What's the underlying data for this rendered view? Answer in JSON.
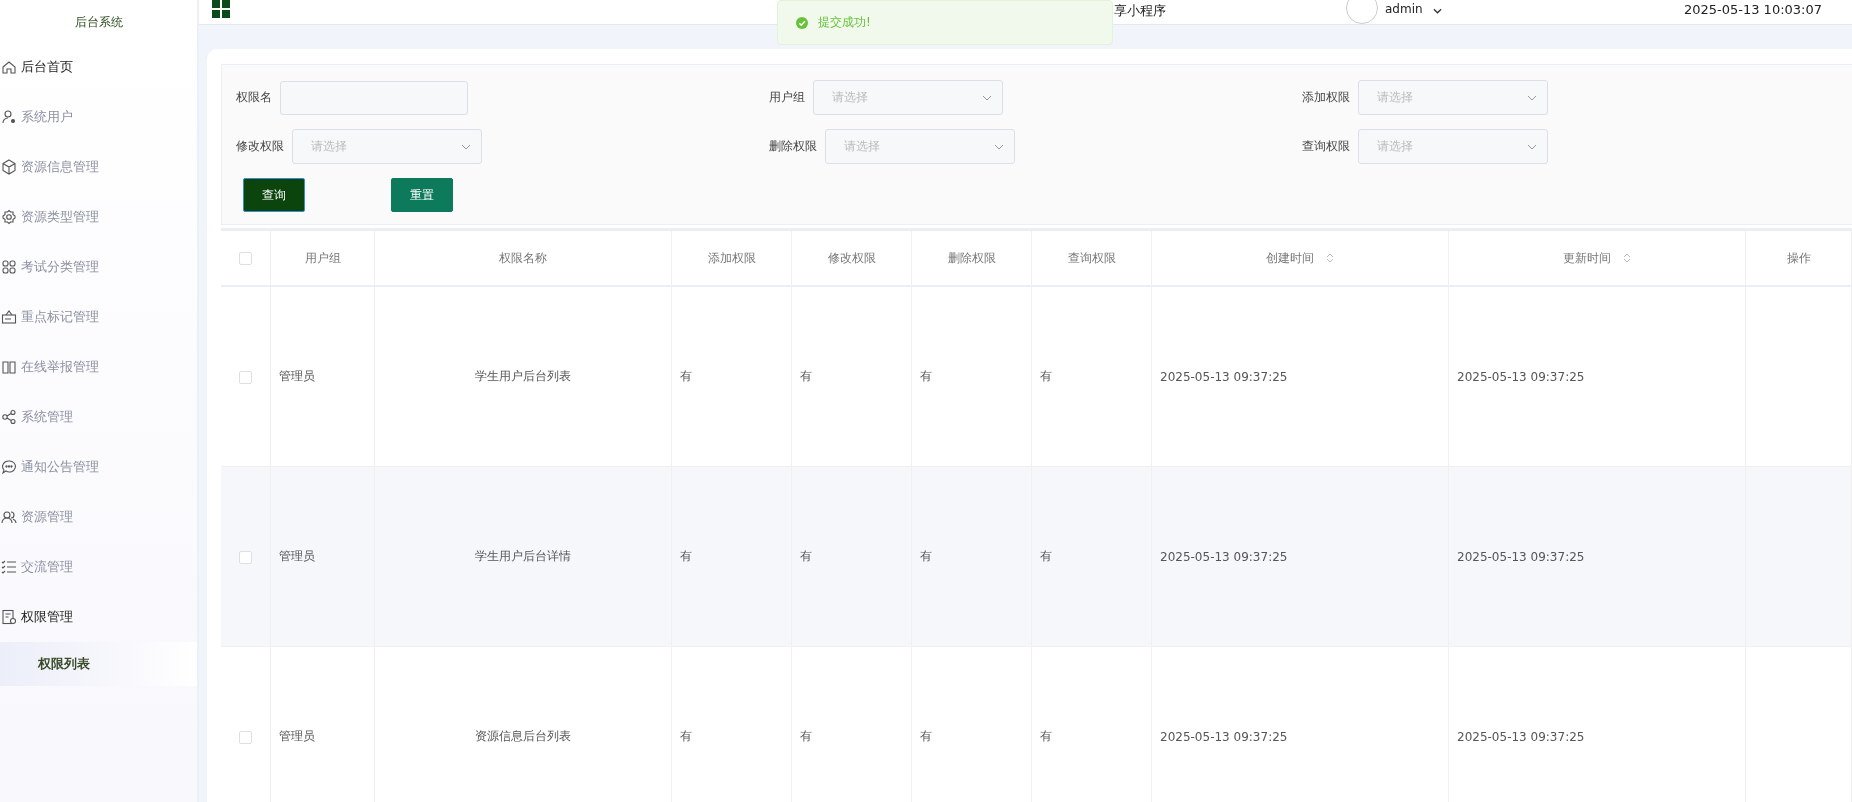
{
  "sidebar": {
    "title": "后台系统",
    "items": [
      {
        "label": "后台首页",
        "active": true
      },
      {
        "label": "系统用户",
        "active": false
      },
      {
        "label": "资源信息管理",
        "active": false
      },
      {
        "label": "资源类型管理",
        "active": false
      },
      {
        "label": "考试分类管理",
        "active": false
      },
      {
        "label": "重点标记管理",
        "active": false
      },
      {
        "label": "在线举报管理",
        "active": false
      },
      {
        "label": "系统管理",
        "active": false
      },
      {
        "label": "通知公告管理",
        "active": false
      },
      {
        "label": "资源管理",
        "active": false
      },
      {
        "label": "交流管理",
        "active": false
      },
      {
        "label": "权限管理",
        "active": true,
        "expanded": true,
        "children": [
          {
            "label": "权限列表",
            "selected": true
          }
        ]
      }
    ]
  },
  "header": {
    "title": "享小程序",
    "user": "admin",
    "datetime": "2025-05-13 10:03:07"
  },
  "toast": {
    "message": "提交成功!"
  },
  "filters": [
    {
      "label": "权限名",
      "kind": "text"
    },
    {
      "label": "用户组",
      "kind": "select",
      "placeholder": "请选择"
    },
    {
      "label": "添加权限",
      "kind": "select",
      "placeholder": "请选择"
    },
    {
      "label": "修改权限",
      "kind": "select",
      "placeholder": "请选择"
    },
    {
      "label": "删除权限",
      "kind": "select",
      "placeholder": "请选择"
    },
    {
      "label": "查询权限",
      "kind": "select",
      "placeholder": "请选择"
    }
  ],
  "buttons": [
    {
      "label": "查询",
      "kind": "primary"
    },
    {
      "label": "重置",
      "kind": "secondary"
    }
  ],
  "table": {
    "select_all_checked": false,
    "columns": [
      {
        "label": "用户组",
        "sortable": false
      },
      {
        "label": "权限名称",
        "sortable": false
      },
      {
        "label": "添加权限",
        "sortable": false
      },
      {
        "label": "修改权限",
        "sortable": false
      },
      {
        "label": "删除权限",
        "sortable": false
      },
      {
        "label": "查询权限",
        "sortable": false
      },
      {
        "label": "创建时间",
        "sortable": true
      },
      {
        "label": "更新时间",
        "sortable": true
      },
      {
        "label": "操作",
        "sortable": false
      }
    ],
    "rows": [
      {
        "checked": false,
        "cells": [
          "管理员",
          "学生用户后台列表",
          "有",
          "有",
          "有",
          "有",
          "2025-05-13 09:37:25",
          "2025-05-13 09:37:25"
        ]
      },
      {
        "checked": false,
        "cells": [
          "管理员",
          "学生用户后台详情",
          "有",
          "有",
          "有",
          "有",
          "2025-05-13 09:37:25",
          "2025-05-13 09:37:25"
        ]
      },
      {
        "checked": false,
        "cells": [
          "管理员",
          "资源信息后台列表",
          "有",
          "有",
          "有",
          "有",
          "2025-05-13 09:37:25",
          "2025-05-13 09:37:25"
        ]
      }
    ]
  }
}
